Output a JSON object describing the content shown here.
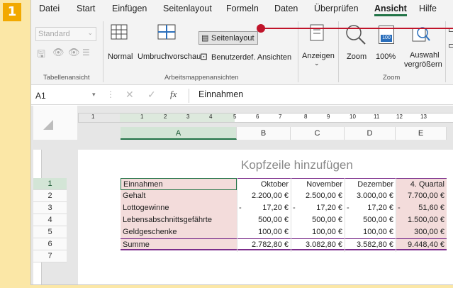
{
  "badge": "1",
  "menu": {
    "tabs": [
      "Datei",
      "Start",
      "Einfügen",
      "Seitenlayout",
      "Formeln",
      "Daten",
      "Überprüfen",
      "Ansicht",
      "Hilfe"
    ]
  },
  "ribbon": {
    "ansichten": {
      "dropdown": "Standard",
      "label": "Tabellenansicht"
    },
    "arbeitsmappen": {
      "normal": "Normal",
      "umbruch": "Umbruchvorschau",
      "seitenlayout": "Seitenlayout",
      "benutzer": "Benutzerdef. Ansichten",
      "label": "Arbeitsmappenansichten"
    },
    "anzeigen": "Anzeigen",
    "zoom": {
      "zoom": "Zoom",
      "hundert": "100%",
      "auswahl1": "Auswahl",
      "auswahl2": "vergrößern",
      "label": "Zoom",
      "icon_number": "100"
    }
  },
  "formula": {
    "namebox": "A1",
    "fx": "fx",
    "content": "Einnahmen"
  },
  "ruler": [
    "1",
    "1",
    "2",
    "3",
    "4",
    "5",
    "6",
    "7",
    "8",
    "9",
    "10",
    "11",
    "12",
    "13"
  ],
  "columns": [
    "A",
    "B",
    "C",
    "D",
    "E"
  ],
  "rows": [
    "1",
    "2",
    "3",
    "4",
    "5",
    "6",
    "7"
  ],
  "header_text": "Kopfzeile hinzufügen",
  "table": {
    "header": [
      "Einnahmen",
      "Oktober",
      "November",
      "Dezember",
      "4. Quartal"
    ],
    "rows": [
      {
        "label": "Gehalt",
        "b": "2.200,00 €",
        "c": "2.500,00 €",
        "d": "3.000,00 €",
        "e": "7.700,00 €"
      },
      {
        "label": "Lottogewinne",
        "b": "17,20 €",
        "c": "17,20 €",
        "d": "17,20 €",
        "e": "51,60 €"
      },
      {
        "label": "Lebensabschnittsgefährte",
        "b": "500,00 €",
        "c": "500,00 €",
        "d": "500,00 €",
        "e": "1.500,00 €"
      },
      {
        "label": "Geldgeschenke",
        "b": "100,00 €",
        "c": "100,00 €",
        "d": "100,00 €",
        "e": "300,00 €"
      }
    ],
    "total": {
      "label": "Summe",
      "b": "2.782,80 €",
      "c": "3.082,80 €",
      "d": "3.582,80 €",
      "e": "9.448,40 €"
    },
    "minus": "-"
  },
  "colors": {
    "accent": "#217346",
    "callout": "#c0142a",
    "pink": "#f3dcdb",
    "purple": "#7b2d8b"
  }
}
